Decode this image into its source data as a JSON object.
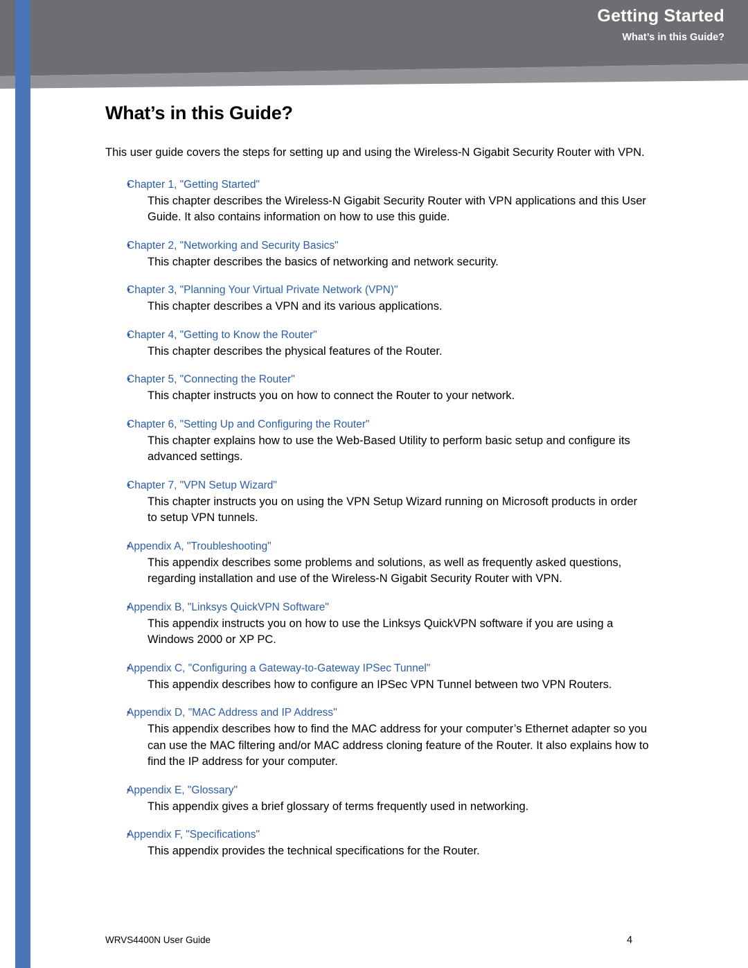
{
  "header": {
    "title": "Getting Started",
    "subtitle": "What’s in this Guide?"
  },
  "page": {
    "title": "What’s in this Guide?",
    "intro": "This user guide covers the steps for setting up and using the Wireless-N Gigabit Security Router with VPN.",
    "items": [
      {
        "bullet": "•",
        "link": "Chapter 1, \"Getting Started\"",
        "desc": "This chapter describes the Wireless-N Gigabit Security Router with VPN applications and this User Guide. It also contains information on how to use this guide."
      },
      {
        "bullet": "•",
        "link": "Chapter 2, \"Networking and Security Basics\"",
        "desc": "This chapter describes the basics of networking and network security."
      },
      {
        "bullet": "•",
        "link": "Chapter 3, \"Planning Your Virtual Private Network (VPN)\"",
        "desc": "This chapter describes a VPN and its various applications."
      },
      {
        "bullet": "•",
        "link": "Chapter 4, \"Getting to Know the Router\"",
        "desc": "This chapter describes the physical features of the Router."
      },
      {
        "bullet": "•",
        "link": "Chapter 5, \"Connecting the Router\"",
        "desc": "This chapter instructs you on how to connect the Router to your network."
      },
      {
        "bullet": "•",
        "link": "Chapter 6, \"Setting Up and Configuring the Router\"",
        "desc": "This chapter explains how to use the Web-Based Utility to perform basic setup and configure its advanced settings."
      },
      {
        "bullet": "•",
        "link": "Chapter 7, \"VPN Setup Wizard\"",
        "desc": "This chapter instructs you on using the VPN Setup Wizard running on Microsoft products in order to setup VPN tunnels."
      },
      {
        "bullet": "•",
        "link": "Appendix A, \"Troubleshooting\"",
        "desc": "This appendix describes some problems and solutions, as well as frequently asked questions, regarding installation and use of the Wireless-N Gigabit Security Router with VPN."
      },
      {
        "bullet": "•",
        "link": "Appendix B, \"Linksys QuickVPN Software\"",
        "desc": "This appendix instructs you on how to use the Linksys QuickVPN software if you are using a Windows 2000 or XP PC."
      },
      {
        "bullet": "•",
        "link": "Appendix C, \"Configuring a Gateway-to-Gateway IPSec Tunnel\"",
        "desc": "This appendix describes how to configure an IPSec VPN Tunnel between two VPN Routers."
      },
      {
        "bullet": "•",
        "link": "Appendix D, \"MAC Address and IP Address\"",
        "desc": "This appendix describes how to find the MAC address for your computer’s Ethernet adapter so you can use the MAC filtering and/or MAC address cloning feature of the Router. It also explains how to find the IP address for your computer."
      },
      {
        "bullet": "•",
        "link": "Appendix E, \"Glossary\"",
        "desc": "This appendix gives a brief glossary of terms frequently used in networking."
      },
      {
        "bullet": "•",
        "link": "Appendix F, \"Specifications\"",
        "desc": "This appendix provides the technical specifications for the Router."
      }
    ]
  },
  "footer": {
    "left": "WRVS4400N User Guide",
    "page_number": "4"
  },
  "colors": {
    "header_dark": "#6d6e71",
    "header_light": "#808285",
    "left_bar": "#4a76b8",
    "left_bar_top": "#2f5fa8",
    "link": "#2b5eaa"
  }
}
